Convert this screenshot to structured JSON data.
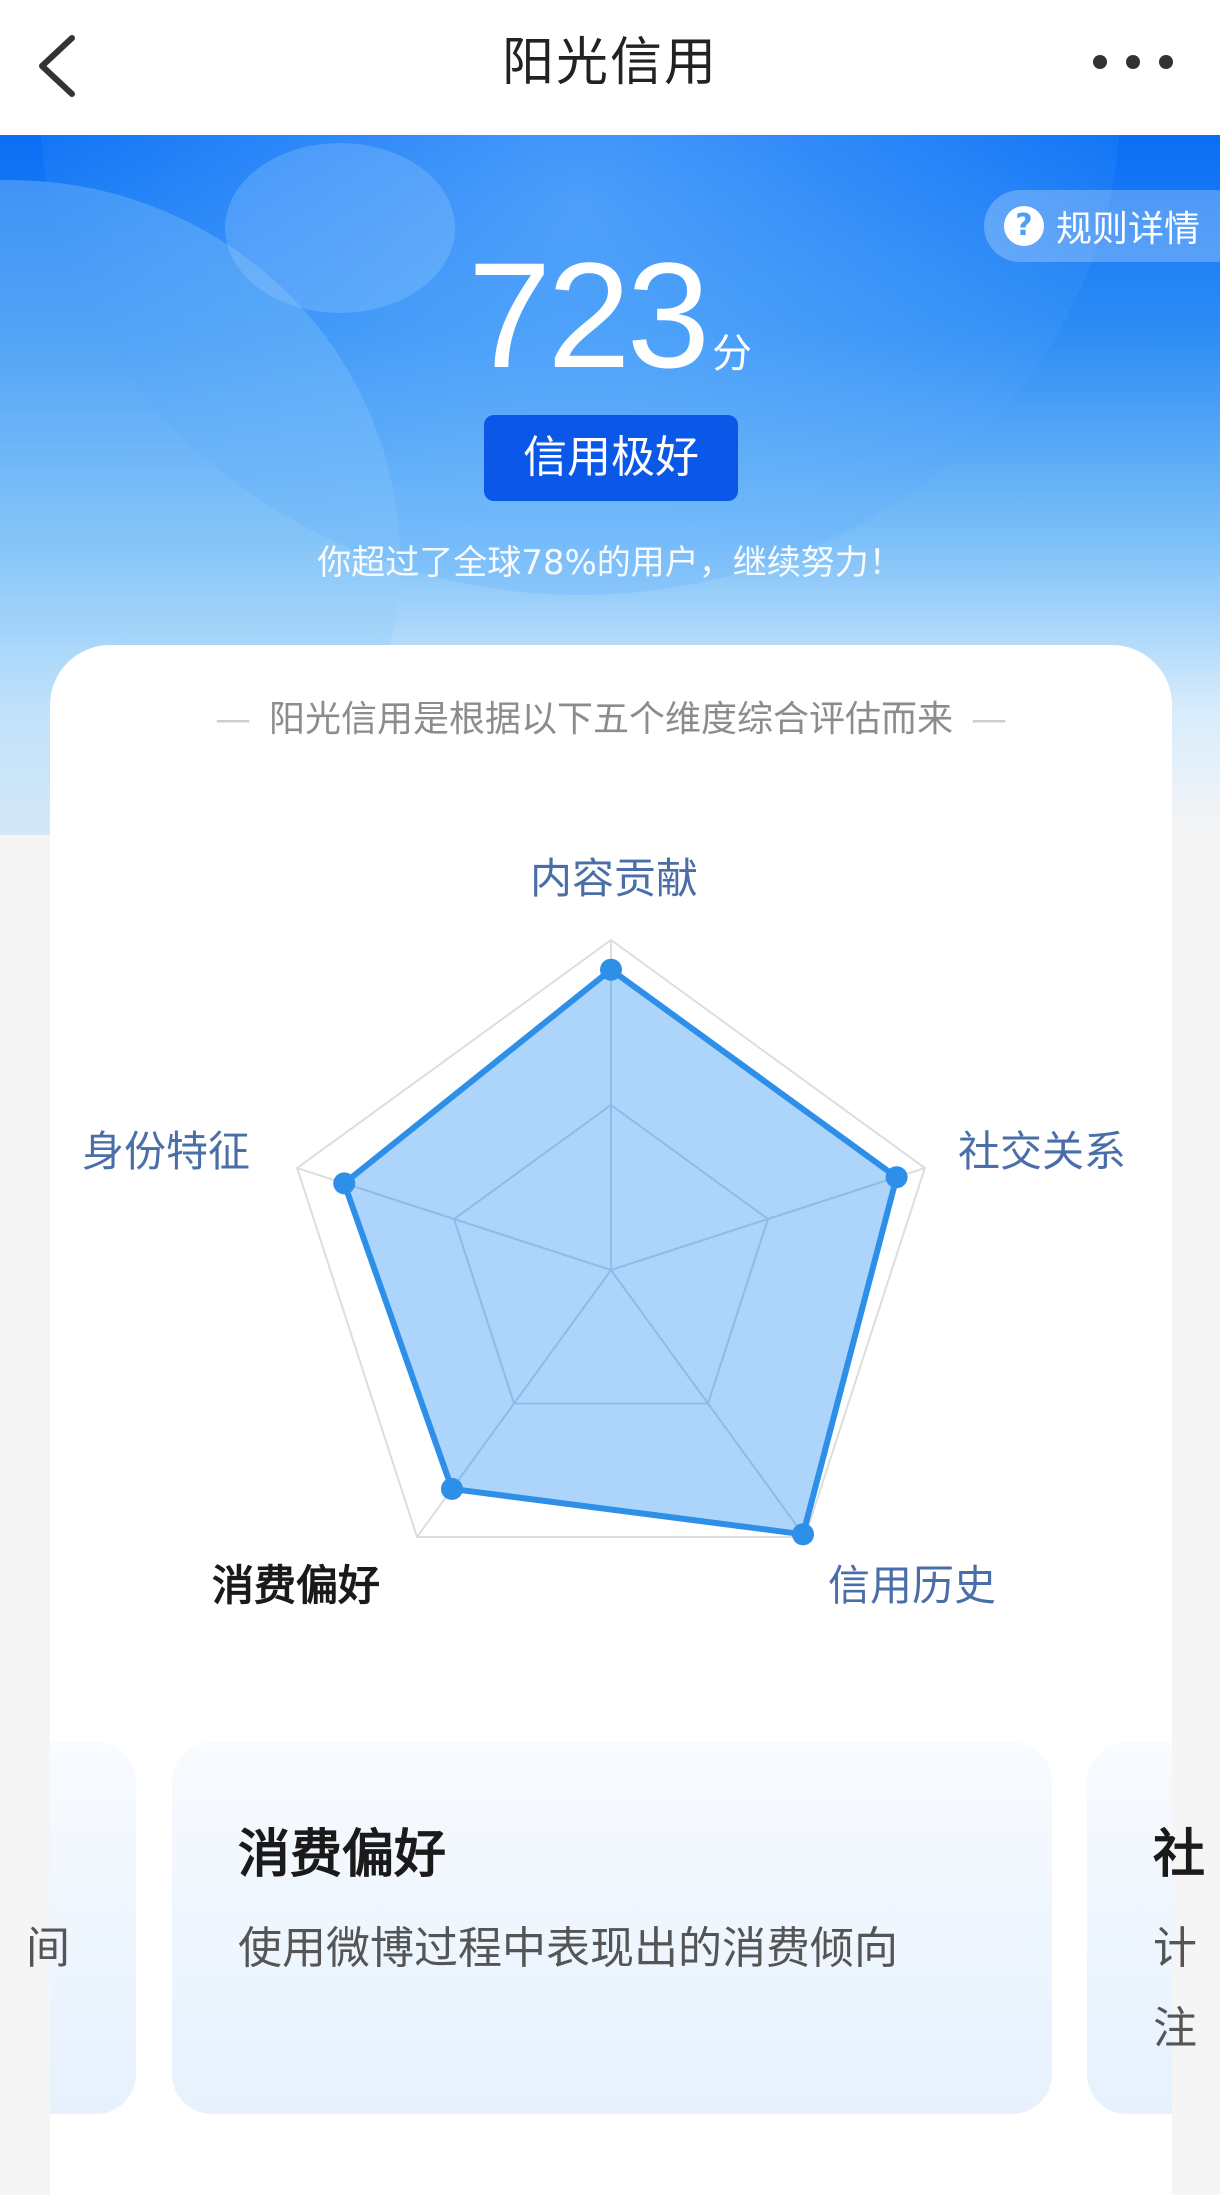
{
  "nav": {
    "title": "阳光信用",
    "back_icon": "chevron-left-icon",
    "more_icon": "more-dots-icon"
  },
  "hero": {
    "rules_label": "规则详情",
    "rules_icon": "question-circle-icon",
    "score": "723",
    "score_unit": "分",
    "level": "信用极好",
    "rank_text": "你超过了全球78%的用户，继续努力！"
  },
  "card": {
    "subtitle": "阳光信用是根据以下五个维度综合评估而来"
  },
  "radar": {
    "dimensions": [
      {
        "label": "内容贡献",
        "value": 0.91
      },
      {
        "label": "社交关系",
        "value": 0.91
      },
      {
        "label": "信用历史",
        "value": 0.99
      },
      {
        "label": "消费偏好",
        "value": 0.82
      },
      {
        "label": "身份特征",
        "value": 0.85
      }
    ],
    "selected": "消费偏好",
    "colors": {
      "line": "#2e8fe8",
      "fill": "#a9d2fb",
      "grid": "#dddddd"
    }
  },
  "info": {
    "main": {
      "title": "消费偏好",
      "desc": "使用微博过程中表现出的消费倾向"
    },
    "right_peek": {
      "title": "社",
      "line1": "计",
      "line2": "注"
    },
    "left_peek": {
      "text": "间"
    }
  }
}
